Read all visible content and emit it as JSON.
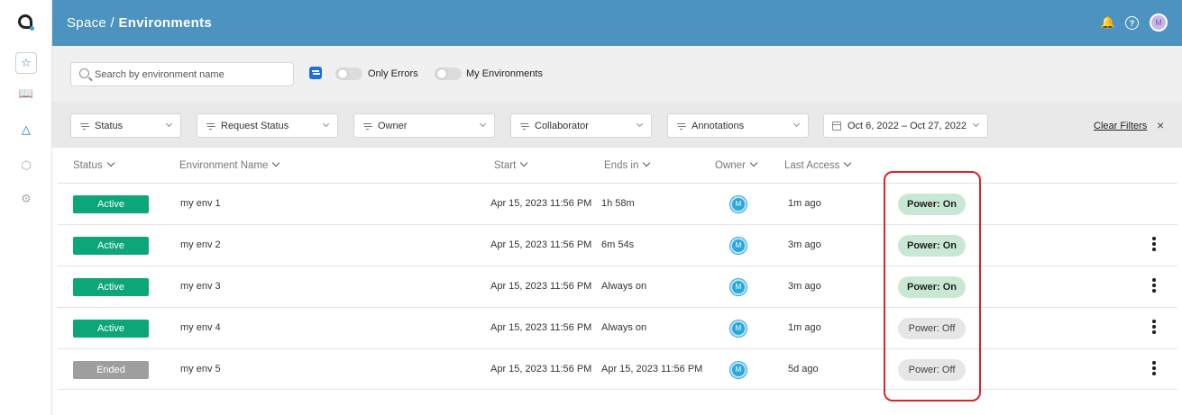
{
  "header": {
    "breadcrumb_parent": "Space",
    "breadcrumb_sep": "/",
    "breadcrumb_current": "Environments",
    "user_initial": "M",
    "help_glyph": "?"
  },
  "search": {
    "placeholder": "Search by environment name",
    "value": ""
  },
  "toggles": {
    "only_errors": "Only Errors",
    "my_environments": "My Environments"
  },
  "filters": {
    "status": "Status",
    "request_status": "Request Status",
    "owner": "Owner",
    "collaborator": "Collaborator",
    "annotations": "Annotations",
    "date_range": "Oct 6, 2022 – Oct 27, 2022",
    "clear": "Clear Filters",
    "clear_x": "×"
  },
  "columns": {
    "status": "Status",
    "name": "Environment Name",
    "start": "Start",
    "ends": "Ends in",
    "owner": "Owner",
    "access": "Last Access"
  },
  "rows": [
    {
      "status": "Active",
      "name": "my env 1",
      "start": "Apr 15, 2023 11:56 PM",
      "ends": "1h 58m",
      "owner": "M",
      "access": "1m ago",
      "power": "Power: On"
    },
    {
      "status": "Active",
      "name": "my env 2",
      "start": "Apr 15, 2023 11:56 PM",
      "ends": "6m 54s",
      "owner": "M",
      "access": "3m ago",
      "power": "Power: On"
    },
    {
      "status": "Active",
      "name": "my env 3",
      "start": "Apr 15, 2023 11:56 PM",
      "ends": "Always on",
      "owner": "M",
      "access": "3m ago",
      "power": "Power: On"
    },
    {
      "status": "Active",
      "name": "my env 4",
      "start": "Apr 15, 2023 11:56 PM",
      "ends": "Always on",
      "owner": "M",
      "access": "1m ago",
      "power": "Power: Off"
    },
    {
      "status": "Ended",
      "name": "my env 5",
      "start": "Apr 15, 2023 11:56 PM",
      "ends": "Apr 15, 2023 11:56 PM",
      "owner": "M",
      "access": "5d ago",
      "power": "Power: Off"
    }
  ],
  "colors": {
    "header_bg": "#4d93c0",
    "active": "#0ca678",
    "ended": "#9e9e9e",
    "power_on": "#c9e8d4",
    "power_off": "#e6e6e6",
    "highlight": "#d8262b"
  },
  "icons": {
    "nav": [
      "logo",
      "blueprints-icon",
      "catalog-icon",
      "environments-icon",
      "packages-icon",
      "settings-icon"
    ],
    "header": [
      "bell-icon",
      "help-icon",
      "user-avatar"
    ]
  }
}
